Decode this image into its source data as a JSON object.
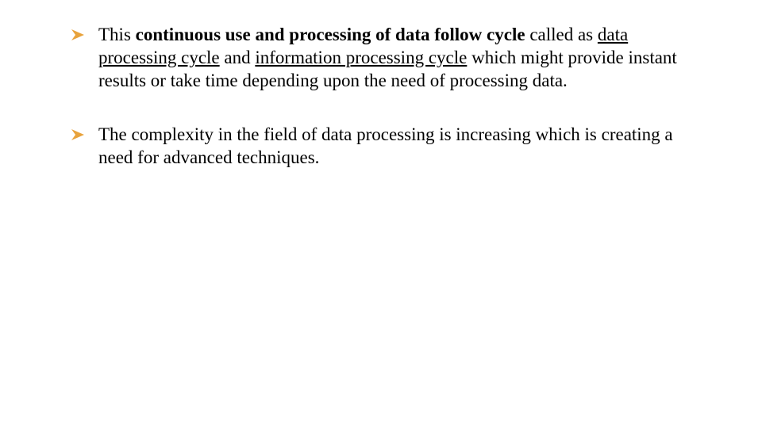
{
  "bullets": [
    {
      "prefix": "This ",
      "bold": "continuous use and processing of data follow cycle",
      "mid1": " called as ",
      "under1": "data processing cycle",
      "mid2": " and ",
      "under2": "information processing cycle",
      "suffix": " which might provide instant results or take time depending upon the need of processing data."
    },
    {
      "text": "The complexity in the field of data processing is increasing which is creating a need for advanced techniques."
    }
  ]
}
